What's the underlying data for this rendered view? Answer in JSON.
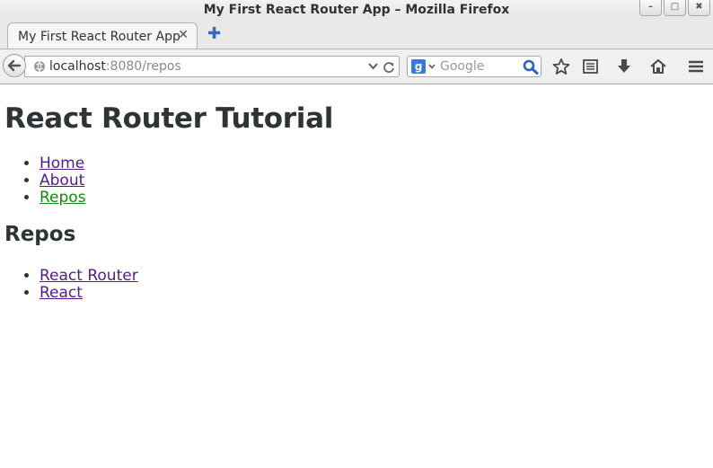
{
  "window": {
    "title": "My First React Router App – Mozilla Firefox",
    "minimize": "–",
    "maximize": "□",
    "close": "✖"
  },
  "tabs": [
    {
      "label": "My First React Router App",
      "close": "✕"
    }
  ],
  "new_tab_label": "✚",
  "address_bar": {
    "host": "localhost",
    "path": ":8080/repos"
  },
  "search": {
    "engine": "g",
    "placeholder": "Google"
  },
  "page": {
    "title": "React Router Tutorial",
    "nav": [
      {
        "label": "Home",
        "active": false
      },
      {
        "label": "About",
        "active": false
      },
      {
        "label": "Repos",
        "active": true
      }
    ],
    "section_title": "Repos",
    "repos": [
      {
        "label": "React Router"
      },
      {
        "label": "React"
      }
    ]
  },
  "colors": {
    "visited_link": "#551a8b",
    "active_link": "#118811",
    "text": "#2e3436"
  },
  "icons": [
    "globe-icon",
    "back-arrow-icon",
    "reload-icon",
    "search-go-icon",
    "bookmark-star-icon",
    "reading-list-icon",
    "download-icon",
    "home-icon",
    "menu-icon"
  ]
}
